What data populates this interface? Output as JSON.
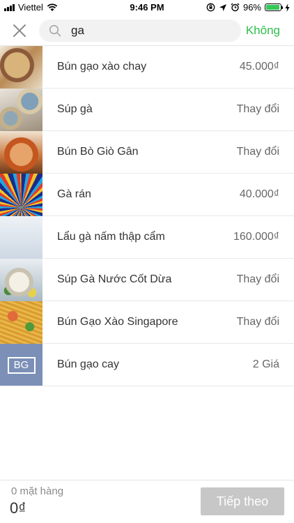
{
  "status_bar": {
    "carrier": "Viettel",
    "time": "9:46 PM",
    "battery_percent": "96%",
    "battery_level": 0.96,
    "icons": [
      "signal-icon",
      "wifi-icon",
      "orientation-lock-icon",
      "location-icon",
      "alarm-icon",
      "battery-icon",
      "charging-icon"
    ]
  },
  "search": {
    "query": "ga",
    "cancel_label": "Không",
    "close_icon": "close-icon",
    "search_icon": "search-icon"
  },
  "items": [
    {
      "name": "Bún gạo xào chay",
      "price": "45.000₫"
    },
    {
      "name": "Súp gà",
      "price": "Thay đổi"
    },
    {
      "name": "Bún Bò Giò Gân",
      "price": "Thay đổi"
    },
    {
      "name": "Gà rán",
      "price": "40.000₫"
    },
    {
      "name": "Lẩu gà nấm thập cẩm",
      "price": "160.000₫"
    },
    {
      "name": "Súp Gà Nước Cốt Dừa",
      "price": "Thay đổi"
    },
    {
      "name": "Bún Gạo Xào Singapore",
      "price": "Thay đổi"
    },
    {
      "name": "Bún gạo cay",
      "price": "2 Giá",
      "thumb_text": "BG"
    }
  ],
  "footer": {
    "item_count": "0 mặt hàng",
    "total": "0₫",
    "next_label": "Tiếp theo"
  },
  "colors": {
    "accent_green": "#2dbe4a",
    "disabled_button": "#c7c7c7",
    "placeholder_thumb": "#7b8fb7"
  }
}
